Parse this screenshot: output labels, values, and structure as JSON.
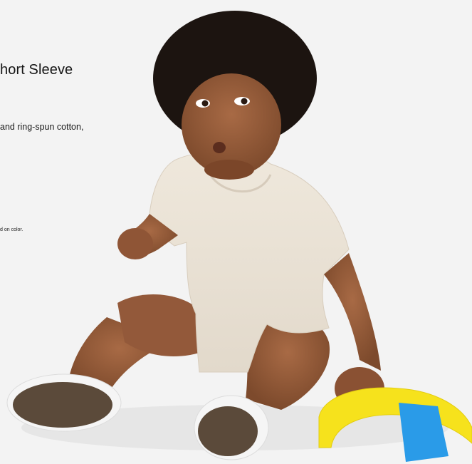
{
  "product": {
    "title": "hort Sleeve",
    "description": "and ring-spun cotton,",
    "note": "d on color."
  },
  "image": {
    "alt": "Toddler sitting on the floor wearing a short-sleeve bodysuit, playing with a stacking toy"
  },
  "colors": {
    "background": "#f3f3f3",
    "text": "#1b1b1b",
    "bodysuit": "#ece4d8",
    "toy_yellow": "#f6e21c",
    "toy_blue": "#2a9be8"
  }
}
